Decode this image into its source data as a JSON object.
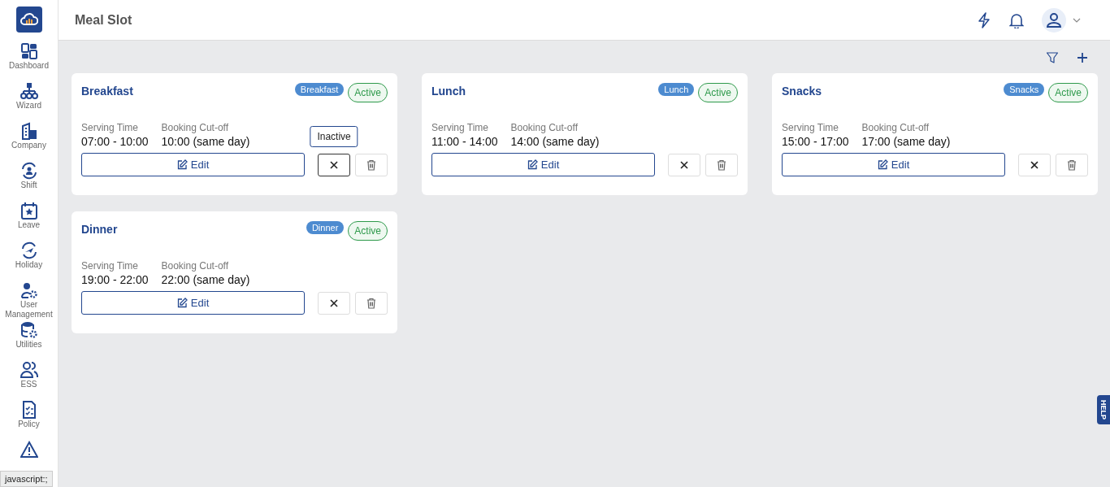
{
  "header": {
    "title": "Meal Slot"
  },
  "sidebar": {
    "items": [
      {
        "kind": "labeled",
        "label": "Dashboard"
      },
      {
        "kind": "labeled",
        "label": "Wizard"
      },
      {
        "kind": "labeled",
        "label": "Company"
      },
      {
        "kind": "labeled",
        "label": "Shift"
      },
      {
        "kind": "labeled",
        "label": "Leave"
      },
      {
        "kind": "labeled",
        "label": "Holiday"
      },
      {
        "kind": "labeled",
        "label": "User Management"
      },
      {
        "kind": "labeled",
        "label": "Utilities"
      },
      {
        "kind": "labeled",
        "label": "ESS"
      },
      {
        "kind": "labeled",
        "label": "Policy"
      },
      {
        "kind": "icon-only"
      }
    ]
  },
  "cards": [
    {
      "title": "Breakfast",
      "tag": "Breakfast",
      "status": "Active",
      "serving_label": "Serving Time",
      "serving": "07:00 - 10:00",
      "cutoff_label": "Booking Cut-off",
      "cutoff": "10:00 (same day)",
      "edit": "Edit",
      "deactivate": {
        "hovered": true,
        "tooltip": "Inactive"
      }
    },
    {
      "title": "Lunch",
      "tag": "Lunch",
      "status": "Active",
      "serving_label": "Serving Time",
      "serving": "11:00 - 14:00",
      "cutoff_label": "Booking Cut-off",
      "cutoff": "14:00 (same day)",
      "edit": "Edit",
      "deactivate": {
        "hovered": false
      }
    },
    {
      "title": "Snacks",
      "tag": "Snacks",
      "status": "Active",
      "serving_label": "Serving Time",
      "serving": "15:00 - 17:00",
      "cutoff_label": "Booking Cut-off",
      "cutoff": "17:00 (same day)",
      "edit": "Edit",
      "deactivate": {
        "hovered": false
      }
    },
    {
      "title": "Dinner",
      "tag": "Dinner",
      "status": "Active",
      "serving_label": "Serving Time",
      "serving": "19:00 - 22:00",
      "cutoff_label": "Booking Cut-off",
      "cutoff": "22:00 (same day)",
      "edit": "Edit",
      "deactivate": {
        "hovered": false
      }
    }
  ],
  "help_tab": "HELP",
  "status_bar": "javascript:;"
}
